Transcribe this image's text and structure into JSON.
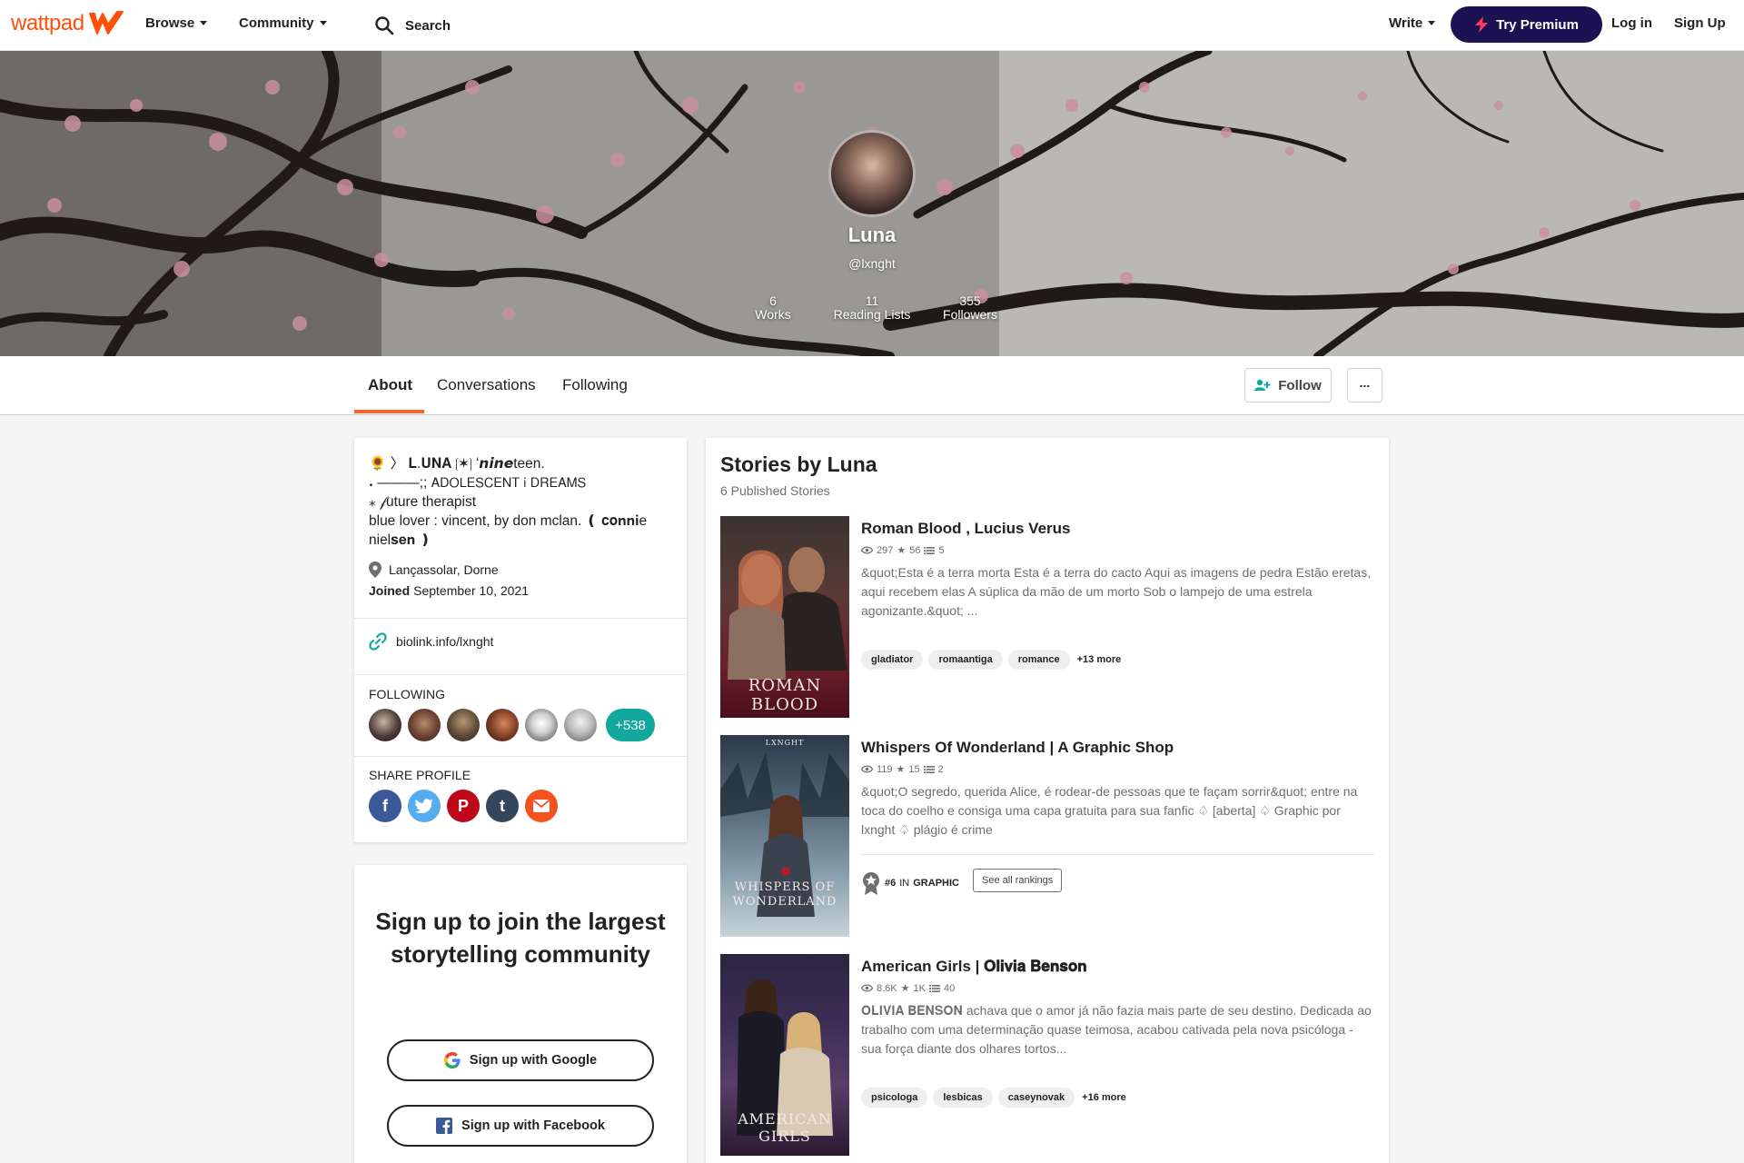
{
  "nav": {
    "logo_text": "wattpad",
    "browse": "Browse",
    "community": "Community",
    "search": "Search",
    "write": "Write",
    "premium": "Try Premium",
    "login": "Log in",
    "signup": "Sign Up"
  },
  "profile": {
    "name": "Luna",
    "handle": "@lxnght",
    "stats": [
      {
        "value": "6",
        "label": "Works"
      },
      {
        "value": "11",
        "label": "Reading Lists"
      },
      {
        "value": "355",
        "label": "Followers"
      }
    ]
  },
  "tabs": [
    "About",
    "Conversations",
    "Following"
  ],
  "actions": {
    "follow": "Follow",
    "more": "..."
  },
  "about": {
    "bio": "🌻 〉 𝐋.𝐔𝐍𝐀  ❲✶❳   ʻ𝙣𝙞𝙣𝙚teen.\n𝆺 ―――;; 𝖠𝖣𝖮𝖫𝖤𝖲𝖢𝖤𝖭𝖳 𝗂 𝖣𝖱𝖤𝖠𝖬𝖲\n ⁎ 𝒻uture therapist\nblue lover : vincent, by don mclan.    ❪ 𝐜𝐨𝐧𝐧𝐢e niel𝐬𝐞𝐧 ❫",
    "location": "Lançassolar, Dorne",
    "joined_label": "Joined",
    "joined_date": "September 10, 2021",
    "link": "biolink.info/lxnght",
    "following_label": "FOLLOWING",
    "following_more": "+538",
    "share_label": "SHARE PROFILE"
  },
  "signup_card": {
    "title": "Sign up to join the largest storytelling community",
    "google": "Sign up with Google",
    "facebook": "Sign up with Facebook"
  },
  "stories": {
    "title": "Stories by Luna",
    "subtitle": "6 Published Stories",
    "items": [
      {
        "title": "Roman Blood , Lucius Verus",
        "reads": "297",
        "votes": "56",
        "parts": "5",
        "description": "&quot;Esta é a terra morta Esta é a terra do cacto Aqui as imagens de pedra Estão eretas, aqui recebem elas A súplica da mão de um morto Sob o lampejo de uma estrela agonizante.&quot; ...",
        "tags": [
          "gladiator",
          "romaantiga",
          "romance"
        ],
        "tags_more": "+13 more",
        "cover_text": "ROMAN BLOOD"
      },
      {
        "title": "Whispers Of Wonderland | A Graphic Shop",
        "reads": "119",
        "votes": "15",
        "parts": "2",
        "description": "&quot;O segredo, querida Alice, é rodear-de pessoas que te façam sorrir&quot; entre na toca do coelho e consiga uma capa gratuita para sua fanfic ♤ [aberta] ♤ Graphic por lxnght ♤ plágio é crime",
        "rank_number": "#6",
        "rank_in": "IN",
        "rank_category": "GRAPHIC",
        "rank_button": "See all rankings",
        "cover_text": "WHISPERS OF WONDERLAND",
        "cover_top": "LXNGHT"
      },
      {
        "title": "American Girls | 𝐎𝐥𝐢𝐯𝐢𝐚 𝐁𝐞𝐧𝐬𝐨𝐧",
        "reads": "8.6K",
        "votes": "1K",
        "parts": "40",
        "description": "𝐎𝐋𝐈𝐕𝐈𝐀 𝐁𝐄𝐍𝐒𝐎𝐍 achava que o amor já não fazia mais parte de seu destino. Dedicada ao trabalho com uma determinação quase teimosa, acabou cativada pela nova psicóloga - sua força diante dos olhares tortos...",
        "tags": [
          "psicologa",
          "lesbicas",
          "caseynovak"
        ],
        "tags_more": "+16 more",
        "cover_text": "AMERICAN GIRLS"
      }
    ]
  },
  "colors": {
    "brand": "#ff500a",
    "premium_bg": "#1c1153",
    "accent_tab": "#ff6122",
    "following_badge": "#13a89e"
  }
}
